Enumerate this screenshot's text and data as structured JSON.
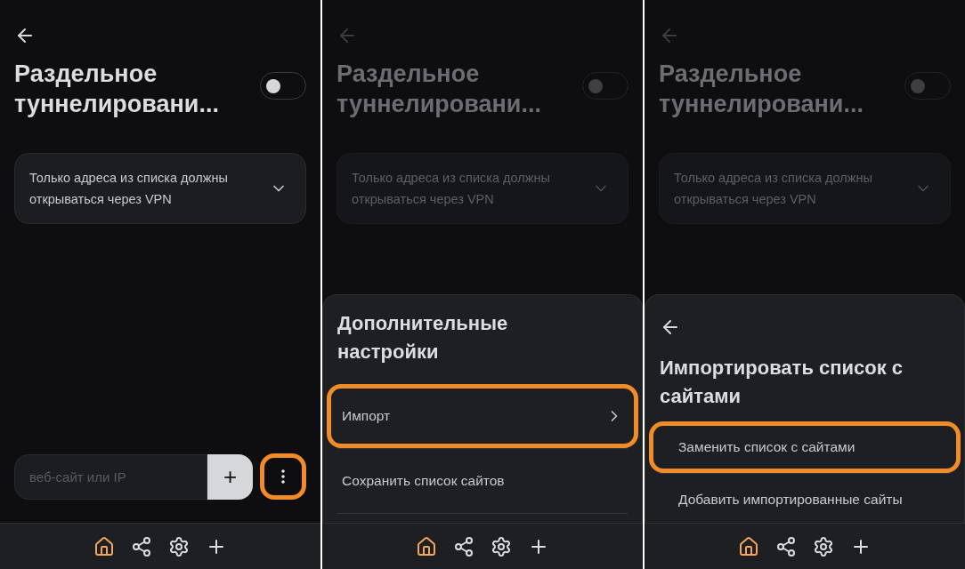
{
  "panels": [
    {
      "screen": {
        "title": "Раздельное туннелировани...",
        "toggle_on": false,
        "mode": {
          "label": "Только адреса из списка должны открываться через VPN",
          "expanded": false
        },
        "dimmed": false
      },
      "input": {
        "placeholder": "веб-сайт или IP",
        "add_label": "+",
        "more_highlighted": true
      },
      "nav": [
        {
          "kind": "home",
          "selected": true
        },
        {
          "kind": "share",
          "selected": false
        },
        {
          "kind": "settings",
          "selected": false
        },
        {
          "kind": "plus",
          "selected": false
        }
      ]
    },
    {
      "screen": {
        "title": "Раздельное туннелировани...",
        "toggle_on": false,
        "mode": {
          "label": "Только адреса из списка должны открываться через VPN",
          "expanded": false
        },
        "dimmed": true
      },
      "sheet": {
        "back": false,
        "title": "Дополнительные настройки",
        "items": [
          {
            "label": "Импорт",
            "chevron": true,
            "highlighted": true
          },
          {
            "label": "Сохранить список сайтов",
            "chevron": false,
            "highlighted": false
          }
        ]
      },
      "nav": [
        {
          "kind": "home",
          "selected": true
        },
        {
          "kind": "share",
          "selected": false
        },
        {
          "kind": "settings",
          "selected": false
        },
        {
          "kind": "plus",
          "selected": false
        }
      ]
    },
    {
      "screen": {
        "title": "Раздельное туннелировани...",
        "toggle_on": false,
        "mode": {
          "label": "Только адреса из списка должны открываться через VPN",
          "expanded": false
        },
        "dimmed": true
      },
      "sheet": {
        "back": true,
        "title": "Импортировать список с сайтами",
        "items": [
          {
            "label": "Заменить список с сайтами",
            "chevron": false,
            "highlighted": true
          },
          {
            "label": "Добавить импортированные сайты",
            "chevron": false,
            "highlighted": false
          }
        ]
      },
      "nav": [
        {
          "kind": "home",
          "selected": true
        },
        {
          "kind": "share",
          "selected": false
        },
        {
          "kind": "settings",
          "selected": false
        },
        {
          "kind": "plus",
          "selected": false
        }
      ]
    }
  ]
}
